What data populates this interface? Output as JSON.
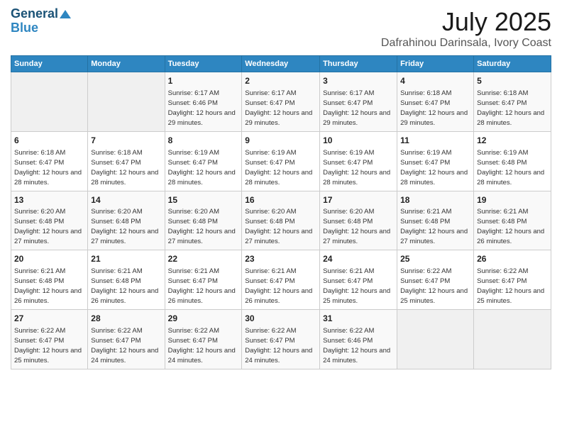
{
  "logo": {
    "line1": "General",
    "line2": "Blue"
  },
  "title": "July 2025",
  "subtitle": "Dafrahinou Darinsala, Ivory Coast",
  "days_of_week": [
    "Sunday",
    "Monday",
    "Tuesday",
    "Wednesday",
    "Thursday",
    "Friday",
    "Saturday"
  ],
  "weeks": [
    [
      {
        "day": "",
        "info": ""
      },
      {
        "day": "",
        "info": ""
      },
      {
        "day": "1",
        "info": "Sunrise: 6:17 AM\nSunset: 6:46 PM\nDaylight: 12 hours and 29 minutes."
      },
      {
        "day": "2",
        "info": "Sunrise: 6:17 AM\nSunset: 6:47 PM\nDaylight: 12 hours and 29 minutes."
      },
      {
        "day": "3",
        "info": "Sunrise: 6:17 AM\nSunset: 6:47 PM\nDaylight: 12 hours and 29 minutes."
      },
      {
        "day": "4",
        "info": "Sunrise: 6:18 AM\nSunset: 6:47 PM\nDaylight: 12 hours and 29 minutes."
      },
      {
        "day": "5",
        "info": "Sunrise: 6:18 AM\nSunset: 6:47 PM\nDaylight: 12 hours and 28 minutes."
      }
    ],
    [
      {
        "day": "6",
        "info": "Sunrise: 6:18 AM\nSunset: 6:47 PM\nDaylight: 12 hours and 28 minutes."
      },
      {
        "day": "7",
        "info": "Sunrise: 6:18 AM\nSunset: 6:47 PM\nDaylight: 12 hours and 28 minutes."
      },
      {
        "day": "8",
        "info": "Sunrise: 6:19 AM\nSunset: 6:47 PM\nDaylight: 12 hours and 28 minutes."
      },
      {
        "day": "9",
        "info": "Sunrise: 6:19 AM\nSunset: 6:47 PM\nDaylight: 12 hours and 28 minutes."
      },
      {
        "day": "10",
        "info": "Sunrise: 6:19 AM\nSunset: 6:47 PM\nDaylight: 12 hours and 28 minutes."
      },
      {
        "day": "11",
        "info": "Sunrise: 6:19 AM\nSunset: 6:47 PM\nDaylight: 12 hours and 28 minutes."
      },
      {
        "day": "12",
        "info": "Sunrise: 6:19 AM\nSunset: 6:48 PM\nDaylight: 12 hours and 28 minutes."
      }
    ],
    [
      {
        "day": "13",
        "info": "Sunrise: 6:20 AM\nSunset: 6:48 PM\nDaylight: 12 hours and 27 minutes."
      },
      {
        "day": "14",
        "info": "Sunrise: 6:20 AM\nSunset: 6:48 PM\nDaylight: 12 hours and 27 minutes."
      },
      {
        "day": "15",
        "info": "Sunrise: 6:20 AM\nSunset: 6:48 PM\nDaylight: 12 hours and 27 minutes."
      },
      {
        "day": "16",
        "info": "Sunrise: 6:20 AM\nSunset: 6:48 PM\nDaylight: 12 hours and 27 minutes."
      },
      {
        "day": "17",
        "info": "Sunrise: 6:20 AM\nSunset: 6:48 PM\nDaylight: 12 hours and 27 minutes."
      },
      {
        "day": "18",
        "info": "Sunrise: 6:21 AM\nSunset: 6:48 PM\nDaylight: 12 hours and 27 minutes."
      },
      {
        "day": "19",
        "info": "Sunrise: 6:21 AM\nSunset: 6:48 PM\nDaylight: 12 hours and 26 minutes."
      }
    ],
    [
      {
        "day": "20",
        "info": "Sunrise: 6:21 AM\nSunset: 6:48 PM\nDaylight: 12 hours and 26 minutes."
      },
      {
        "day": "21",
        "info": "Sunrise: 6:21 AM\nSunset: 6:48 PM\nDaylight: 12 hours and 26 minutes."
      },
      {
        "day": "22",
        "info": "Sunrise: 6:21 AM\nSunset: 6:47 PM\nDaylight: 12 hours and 26 minutes."
      },
      {
        "day": "23",
        "info": "Sunrise: 6:21 AM\nSunset: 6:47 PM\nDaylight: 12 hours and 26 minutes."
      },
      {
        "day": "24",
        "info": "Sunrise: 6:21 AM\nSunset: 6:47 PM\nDaylight: 12 hours and 25 minutes."
      },
      {
        "day": "25",
        "info": "Sunrise: 6:22 AM\nSunset: 6:47 PM\nDaylight: 12 hours and 25 minutes."
      },
      {
        "day": "26",
        "info": "Sunrise: 6:22 AM\nSunset: 6:47 PM\nDaylight: 12 hours and 25 minutes."
      }
    ],
    [
      {
        "day": "27",
        "info": "Sunrise: 6:22 AM\nSunset: 6:47 PM\nDaylight: 12 hours and 25 minutes."
      },
      {
        "day": "28",
        "info": "Sunrise: 6:22 AM\nSunset: 6:47 PM\nDaylight: 12 hours and 24 minutes."
      },
      {
        "day": "29",
        "info": "Sunrise: 6:22 AM\nSunset: 6:47 PM\nDaylight: 12 hours and 24 minutes."
      },
      {
        "day": "30",
        "info": "Sunrise: 6:22 AM\nSunset: 6:47 PM\nDaylight: 12 hours and 24 minutes."
      },
      {
        "day": "31",
        "info": "Sunrise: 6:22 AM\nSunset: 6:46 PM\nDaylight: 12 hours and 24 minutes."
      },
      {
        "day": "",
        "info": ""
      },
      {
        "day": "",
        "info": ""
      }
    ]
  ]
}
